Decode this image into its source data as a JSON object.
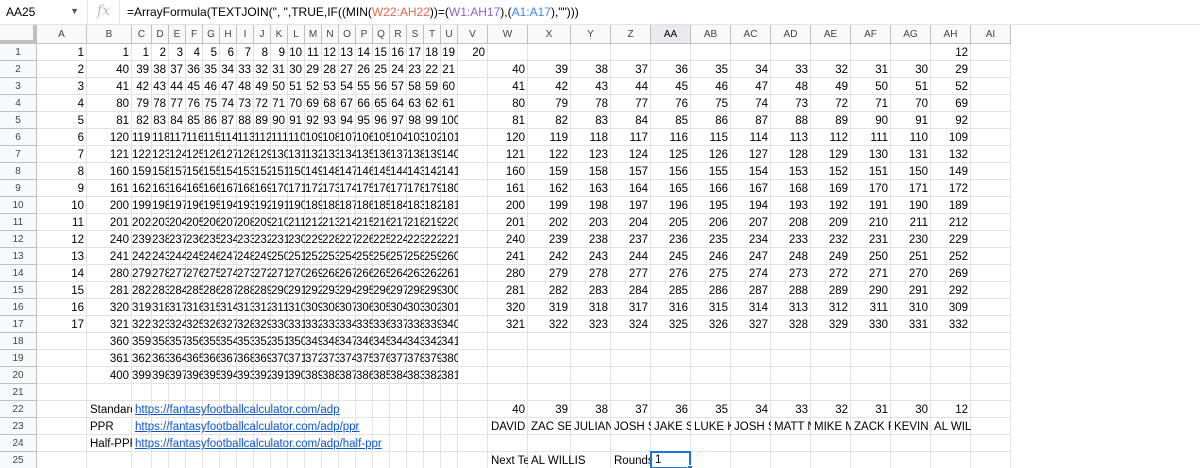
{
  "name_box": "AA25",
  "fx_label": "fx",
  "formula": {
    "parts": [
      {
        "t": "=ArrayFormula(TEXTJOIN(\", \",TRUE,IF((MIN(",
        "c": ""
      },
      {
        "t": "W22:AH22",
        "c": "red"
      },
      {
        "t": "))=(",
        "c": ""
      },
      {
        "t": "W1:AH17",
        "c": "purple"
      },
      {
        "t": "),(",
        "c": ""
      },
      {
        "t": "A1:A17",
        "c": "blue"
      },
      {
        "t": "),\"\")))",
        "c": ""
      }
    ]
  },
  "columns": [
    "A",
    "B",
    "C",
    "D",
    "E",
    "F",
    "G",
    "H",
    "I",
    "J",
    "K",
    "L",
    "M",
    "N",
    "O",
    "P",
    "Q",
    "R",
    "S",
    "T",
    "U",
    "V",
    "W",
    "X",
    "Y",
    "Z",
    "AA",
    "AB",
    "AC",
    "AD",
    "AE",
    "AF",
    "AG",
    "AH",
    "AI"
  ],
  "selected_column": "AA",
  "rows": [
    "1",
    "2",
    "3",
    "4",
    "5",
    "6",
    "7",
    "8",
    "9",
    "10",
    "11",
    "12",
    "13",
    "14",
    "15",
    "16",
    "17",
    "18",
    "19",
    "20",
    "21",
    "22",
    "23",
    "24",
    "25"
  ],
  "col_a": [
    "1",
    "2",
    "3",
    "4",
    "5",
    "6",
    "7",
    "8",
    "9",
    "10",
    "11",
    "12",
    "13",
    "14",
    "15",
    "16",
    "17"
  ],
  "grid_bu": [
    [
      1,
      1,
      2,
      3,
      4,
      5,
      6,
      7,
      8,
      9,
      10,
      11,
      12,
      13,
      14,
      15,
      16,
      17,
      18,
      19,
      20
    ],
    [
      40,
      39,
      38,
      37,
      36,
      35,
      34,
      33,
      32,
      31,
      30,
      29,
      28,
      27,
      26,
      25,
      24,
      23,
      22,
      21
    ],
    [
      41,
      42,
      43,
      44,
      45,
      46,
      47,
      48,
      49,
      50,
      51,
      52,
      53,
      54,
      55,
      56,
      57,
      58,
      59,
      60
    ],
    [
      80,
      79,
      78,
      77,
      76,
      75,
      74,
      73,
      72,
      71,
      70,
      69,
      68,
      67,
      66,
      65,
      64,
      63,
      62,
      61
    ],
    [
      81,
      82,
      83,
      84,
      85,
      86,
      87,
      88,
      89,
      90,
      91,
      92,
      93,
      94,
      95,
      96,
      97,
      98,
      99,
      100
    ],
    [
      120,
      119,
      118,
      117,
      116,
      115,
      114,
      113,
      112,
      111,
      110,
      109,
      108,
      107,
      106,
      105,
      104,
      103,
      102,
      101
    ],
    [
      121,
      122,
      123,
      124,
      125,
      126,
      127,
      128,
      129,
      130,
      131,
      132,
      133,
      134,
      135,
      136,
      137,
      138,
      139,
      140
    ],
    [
      160,
      159,
      158,
      157,
      156,
      155,
      154,
      153,
      152,
      151,
      150,
      149,
      148,
      147,
      146,
      145,
      144,
      143,
      142,
      141
    ],
    [
      161,
      162,
      163,
      164,
      165,
      166,
      167,
      168,
      169,
      170,
      171,
      172,
      173,
      174,
      175,
      176,
      177,
      178,
      179,
      180
    ],
    [
      200,
      199,
      198,
      197,
      196,
      195,
      194,
      193,
      192,
      191,
      190,
      189,
      188,
      187,
      186,
      185,
      184,
      183,
      182,
      181
    ],
    [
      201,
      202,
      203,
      204,
      205,
      206,
      207,
      208,
      209,
      210,
      211,
      212,
      213,
      214,
      215,
      216,
      217,
      218,
      219,
      220
    ],
    [
      240,
      239,
      238,
      237,
      236,
      235,
      234,
      233,
      232,
      231,
      230,
      229,
      228,
      227,
      226,
      225,
      224,
      223,
      222,
      221
    ],
    [
      241,
      242,
      243,
      244,
      245,
      246,
      247,
      248,
      249,
      250,
      251,
      252,
      253,
      254,
      255,
      256,
      257,
      258,
      259,
      260
    ],
    [
      280,
      279,
      278,
      277,
      276,
      275,
      274,
      273,
      272,
      271,
      270,
      269,
      268,
      267,
      266,
      265,
      264,
      263,
      262,
      261
    ],
    [
      281,
      282,
      283,
      284,
      285,
      286,
      287,
      288,
      289,
      290,
      291,
      292,
      293,
      294,
      295,
      296,
      297,
      298,
      299,
      300
    ],
    [
      320,
      319,
      318,
      317,
      316,
      315,
      314,
      313,
      312,
      311,
      310,
      309,
      308,
      307,
      306,
      305,
      304,
      303,
      302,
      301
    ],
    [
      321,
      322,
      323,
      324,
      325,
      326,
      327,
      328,
      329,
      330,
      331,
      332,
      333,
      334,
      335,
      336,
      337,
      338,
      339,
      340
    ],
    [
      360,
      359,
      358,
      357,
      356,
      355,
      354,
      353,
      352,
      351,
      350,
      349,
      348,
      347,
      346,
      345,
      344,
      343,
      342,
      341
    ],
    [
      361,
      362,
      363,
      364,
      365,
      366,
      367,
      368,
      369,
      370,
      371,
      372,
      373,
      374,
      375,
      376,
      377,
      378,
      379,
      380
    ],
    [
      400,
      399,
      398,
      397,
      396,
      395,
      394,
      393,
      392,
      391,
      390,
      389,
      388,
      387,
      386,
      385,
      384,
      383,
      382,
      381
    ]
  ],
  "grid_wah_row1": [
    "",
    "",
    "",
    "",
    "",
    "",
    "",
    "",
    "",
    "",
    "",
    "12"
  ],
  "grid_wah": [
    [
      40,
      39,
      38,
      37,
      36,
      35,
      34,
      33,
      32,
      31,
      30,
      29
    ],
    [
      41,
      42,
      43,
      44,
      45,
      46,
      47,
      48,
      49,
      50,
      51,
      52
    ],
    [
      80,
      79,
      78,
      77,
      76,
      75,
      74,
      73,
      72,
      71,
      70,
      69
    ],
    [
      81,
      82,
      83,
      84,
      85,
      86,
      87,
      88,
      89,
      90,
      91,
      92
    ],
    [
      120,
      119,
      118,
      117,
      116,
      115,
      114,
      113,
      112,
      111,
      110,
      109
    ],
    [
      121,
      122,
      123,
      124,
      125,
      126,
      127,
      128,
      129,
      130,
      131,
      132
    ],
    [
      160,
      159,
      158,
      157,
      156,
      155,
      154,
      153,
      152,
      151,
      150,
      149
    ],
    [
      161,
      162,
      163,
      164,
      165,
      166,
      167,
      168,
      169,
      170,
      171,
      172
    ],
    [
      200,
      199,
      198,
      197,
      196,
      195,
      194,
      193,
      192,
      191,
      190,
      189
    ],
    [
      201,
      202,
      203,
      204,
      205,
      206,
      207,
      208,
      209,
      210,
      211,
      212
    ],
    [
      240,
      239,
      238,
      237,
      236,
      235,
      234,
      233,
      232,
      231,
      230,
      229
    ],
    [
      241,
      242,
      243,
      244,
      245,
      246,
      247,
      248,
      249,
      250,
      251,
      252
    ],
    [
      280,
      279,
      278,
      277,
      276,
      275,
      274,
      273,
      272,
      271,
      270,
      269
    ],
    [
      281,
      282,
      283,
      284,
      285,
      286,
      287,
      288,
      289,
      290,
      291,
      292
    ],
    [
      320,
      319,
      318,
      317,
      316,
      315,
      314,
      313,
      312,
      311,
      310,
      309
    ],
    [
      321,
      322,
      323,
      324,
      325,
      326,
      327,
      328,
      329,
      330,
      331,
      332
    ]
  ],
  "row22_wah": [
    "40",
    "39",
    "38",
    "37",
    "36",
    "35",
    "34",
    "33",
    "32",
    "31",
    "30",
    "12"
  ],
  "row23_names": [
    "DAVID SEB",
    "ZAC SE",
    "JULIAN",
    "JOSH SE",
    "JAKE S",
    "LUKE K",
    "JOSH S",
    "MATT N",
    "MIKE M",
    "ZACK FE",
    "KEVIN C",
    "AL WILLI"
  ],
  "links": [
    {
      "label": "Standard",
      "url": "https://fantasyfootballcalculator.com/adp"
    },
    {
      "label": "PPR",
      "url": "https://fantasyfootballcalculator.com/adp/ppr"
    },
    {
      "label": "Half-PPR",
      "url": "https://fantasyfootballcalculator.com/adp/half-ppr"
    }
  ],
  "next_team_label": "Next Team:",
  "next_team_value": "AL WILLIS",
  "rounds_label": "Rounds:",
  "rounds_value": "1"
}
